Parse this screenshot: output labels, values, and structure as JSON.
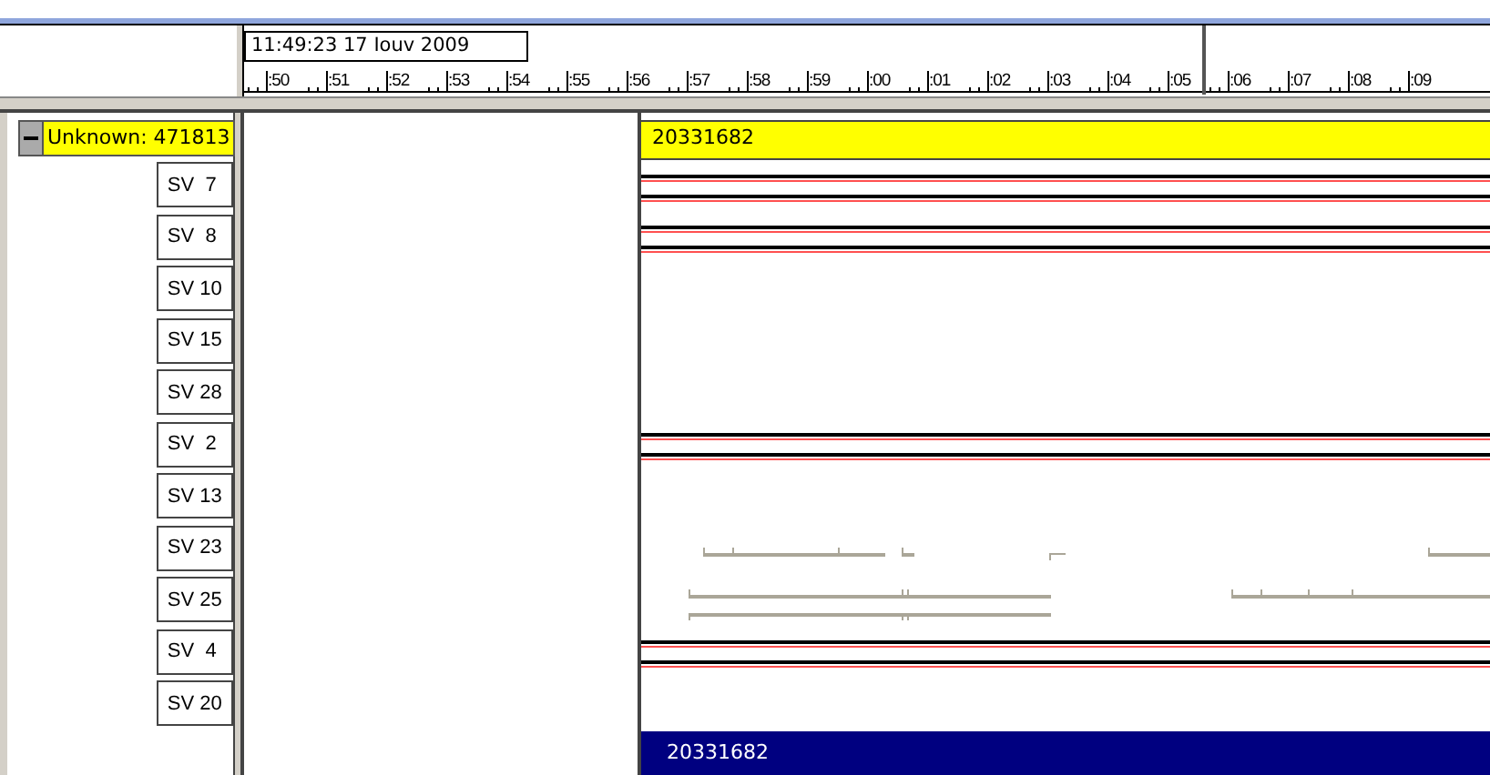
{
  "timeline": {
    "timestamp": "11:49:23 17 Iouv 2009",
    "ticks": [
      ":50",
      ":51",
      ":52",
      ":53",
      ":54",
      ":55",
      ":56",
      ":57",
      ":58",
      ":59",
      ":00",
      ":01",
      ":02",
      ":03",
      ":04",
      ":05",
      ":06",
      ":07",
      ":08",
      ":09"
    ]
  },
  "tree": {
    "node": {
      "label": "Unknown: 471813",
      "expanded": true
    },
    "items": [
      {
        "label": "SV  7",
        "kind": "solid"
      },
      {
        "label": "SV  8",
        "kind": "solid"
      },
      {
        "label": "SV 10",
        "kind": "empty"
      },
      {
        "label": "SV 15",
        "kind": "empty"
      },
      {
        "label": "SV 28",
        "kind": "empty"
      },
      {
        "label": "SV  2",
        "kind": "solid"
      },
      {
        "label": "SV 13",
        "kind": "empty"
      },
      {
        "label": "SV 23",
        "kind": "sparse"
      },
      {
        "label": "SV 25",
        "kind": "dense"
      },
      {
        "label": "SV  4",
        "kind": "solid"
      },
      {
        "label": "SV 20",
        "kind": "empty"
      }
    ]
  },
  "track": {
    "header": "20331682",
    "footer": "20331682"
  }
}
